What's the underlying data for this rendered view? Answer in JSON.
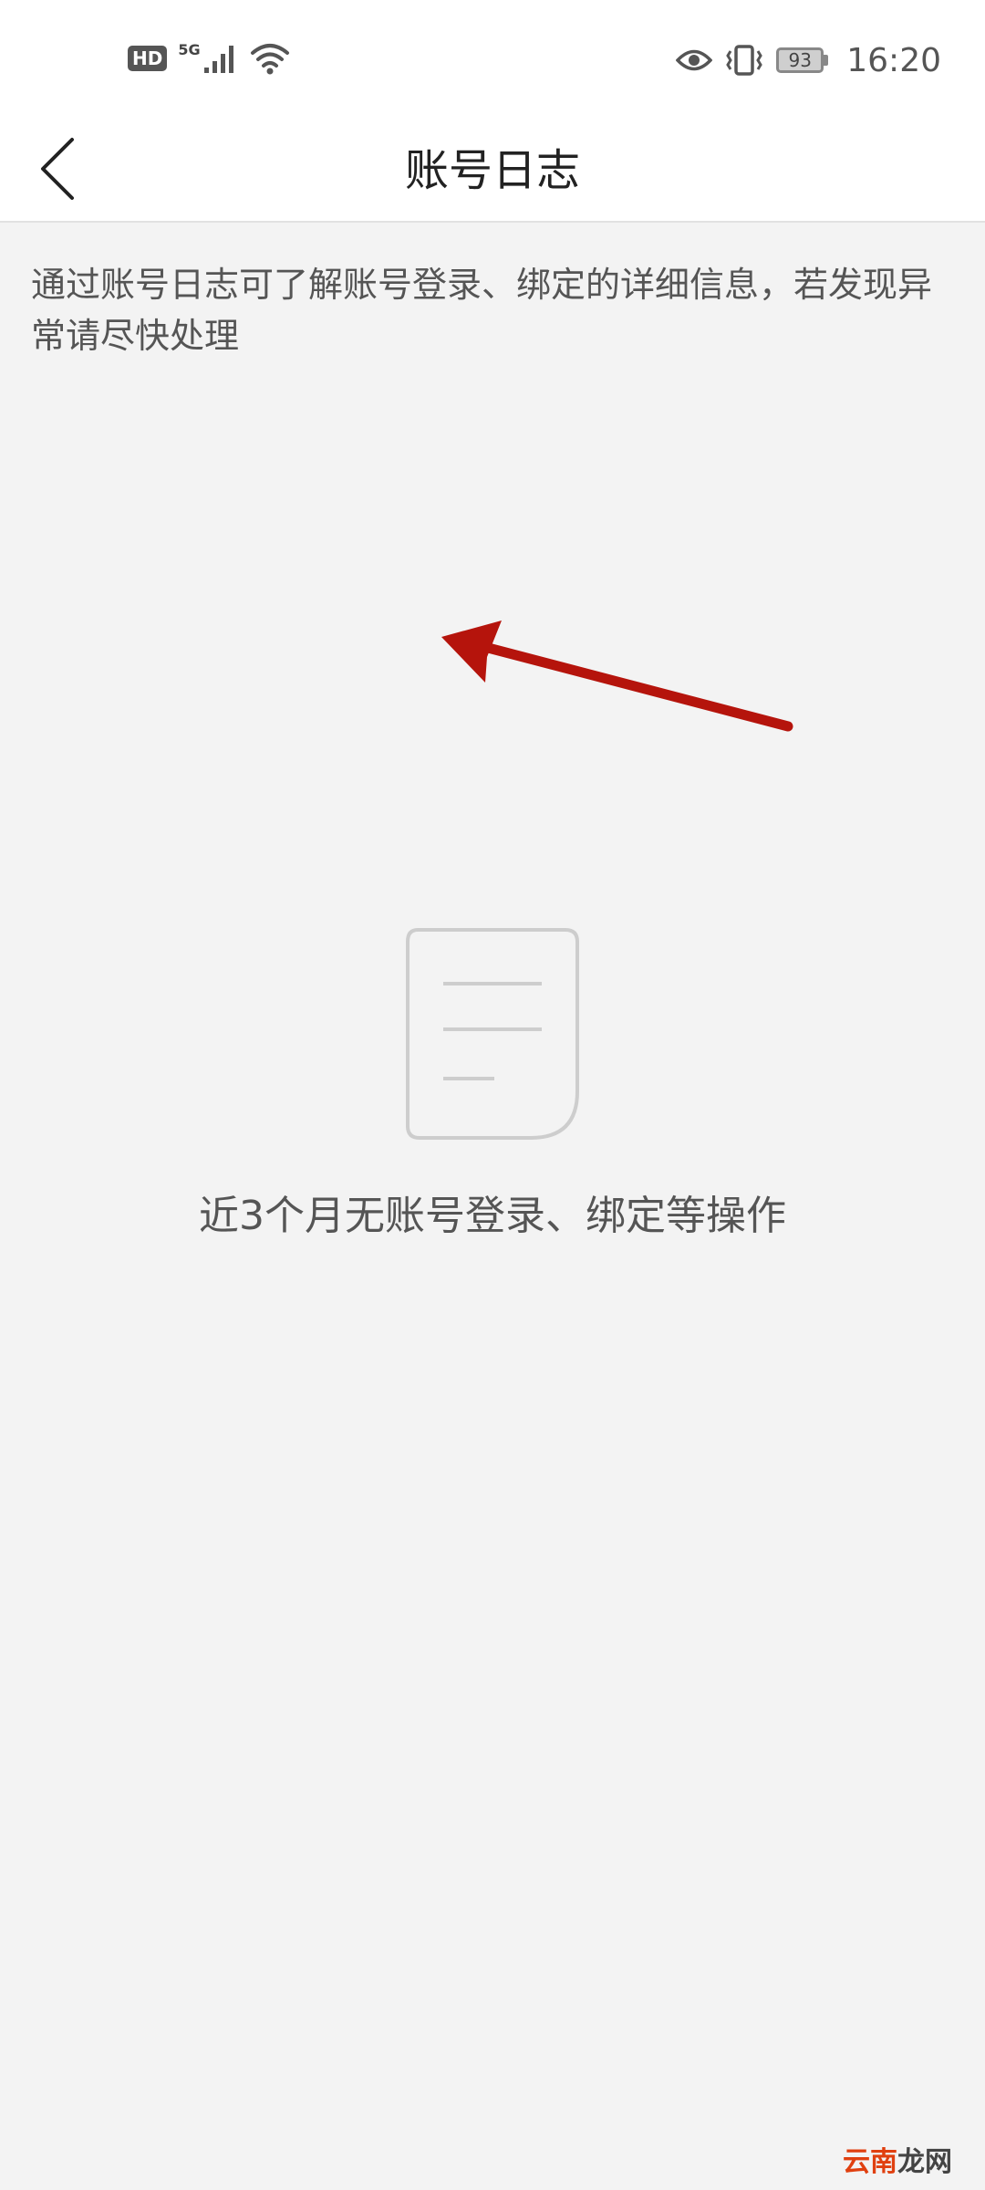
{
  "status_bar": {
    "hd_label": "HD",
    "network_type": "5G",
    "battery_level": "93",
    "time": "16:20",
    "icons": [
      "hd-icon",
      "signal-icon",
      "wifi-icon",
      "eye-icon",
      "vibrate-icon",
      "battery-icon"
    ]
  },
  "header": {
    "title": "账号日志",
    "back_icon": "chevron-left-icon"
  },
  "main": {
    "description": "通过账号日志可了解账号登录、绑定的详细信息，若发现异常请尽快处理",
    "empty_state": {
      "icon": "document-icon",
      "message": "近3个月无账号登录、绑定等操作"
    }
  },
  "annotation": {
    "arrow_color": "#b5140c"
  },
  "watermark": {
    "part1": "云南",
    "part2": "龙网"
  }
}
